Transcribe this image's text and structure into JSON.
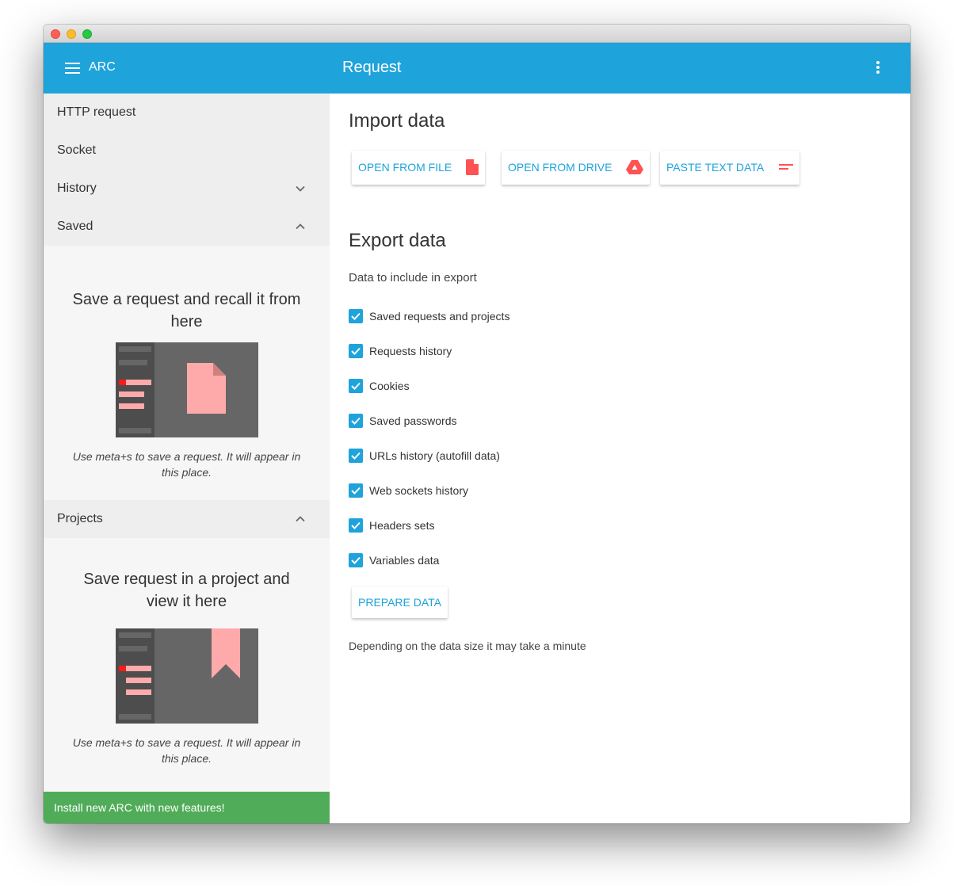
{
  "window": {
    "controls": [
      "close",
      "minimize",
      "maximize"
    ]
  },
  "appbar": {
    "app_name": "ARC",
    "title": "Request",
    "menu_icon": "hamburger-menu-icon",
    "more_icon": "more-vert-icon"
  },
  "drawer": {
    "nav": [
      {
        "label": "HTTP request"
      },
      {
        "label": "Socket"
      },
      {
        "label": "History",
        "icon": "chevron-down-icon"
      },
      {
        "label": "Saved",
        "icon": "chevron-up-icon"
      }
    ],
    "saved_empty": {
      "title": "Save a request and recall it from here",
      "desc": "Use meta+s to save a request. It will appear in this place."
    },
    "projects": {
      "label": "Projects",
      "icon": "chevron-up-icon"
    },
    "projects_empty": {
      "title": "Save request in a project and view it here",
      "desc": "Use meta+s to save a request. It will appear in this place."
    },
    "promo": "Install new ARC with new features!"
  },
  "colors": {
    "primary": "#1ea3db",
    "accent_red": "#ff5252",
    "promo_green": "#51ac59"
  },
  "main": {
    "import": {
      "title": "Import data",
      "buttons": [
        {
          "label": "OPEN FROM FILE",
          "icon": "file-icon"
        },
        {
          "label": "OPEN FROM DRIVE",
          "icon": "google-drive-icon"
        },
        {
          "label": "PASTE TEXT DATA",
          "icon": "short-text-icon"
        }
      ]
    },
    "export": {
      "title": "Export data",
      "subtitle": "Data to include in export",
      "options": [
        {
          "label": "Saved requests and projects",
          "checked": true
        },
        {
          "label": "Requests history",
          "checked": true
        },
        {
          "label": "Cookies",
          "checked": true
        },
        {
          "label": "Saved passwords",
          "checked": true
        },
        {
          "label": "URLs history (autofill data)",
          "checked": true
        },
        {
          "label": "Web sockets history",
          "checked": true
        },
        {
          "label": "Headers sets",
          "checked": true
        },
        {
          "label": "Variables data",
          "checked": true
        }
      ],
      "prepare_button": "PREPARE DATA",
      "note": "Depending on the data size it may take a minute"
    }
  }
}
